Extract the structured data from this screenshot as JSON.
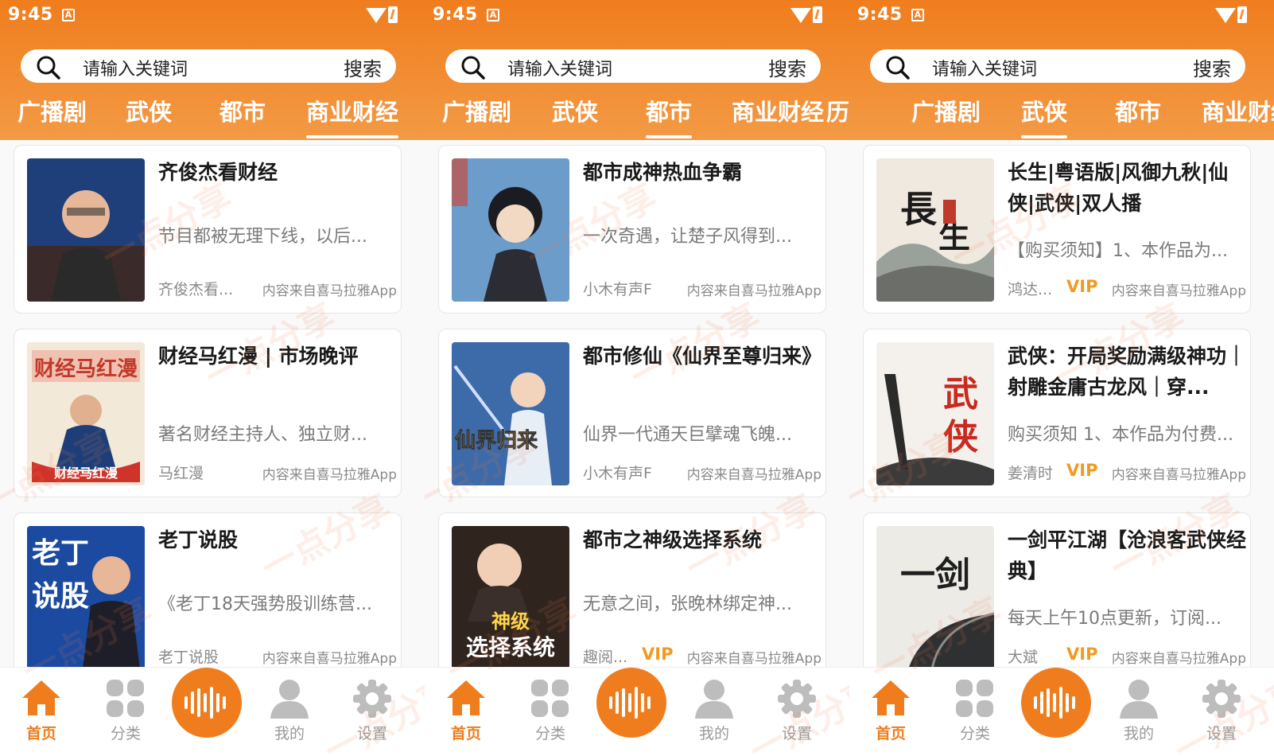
{
  "colors": {
    "accent": "#f07d1d",
    "vip": "#f29a1f"
  },
  "panels": [
    {
      "status": {
        "time": "9:45",
        "badge": "A"
      },
      "search": {
        "placeholder": "请输入关键词",
        "button": "搜索"
      },
      "tabs": [
        {
          "label": "广播剧",
          "active": false
        },
        {
          "label": "武侠",
          "active": false
        },
        {
          "label": "都市",
          "active": false
        },
        {
          "label": "商业财经",
          "active": true
        }
      ],
      "cards": [
        {
          "title": "齐俊杰看财经",
          "desc": "节目都被无理下线，以后...",
          "author": "齐俊杰看...",
          "vip": "",
          "source": "内容来自喜马拉雅App",
          "cover": "portrait-blue"
        },
        {
          "title": "财经马红漫 | 市场晚评",
          "desc": "著名财经主持人、独立财...",
          "author": "马红漫",
          "vip": "",
          "source": "内容来自喜马拉雅App",
          "cover": "mahongman"
        },
        {
          "title": "老丁说股",
          "desc": "《老丁18天强势股训练营...",
          "author": "老丁说股",
          "vip": "",
          "source": "内容来自喜马拉雅App",
          "cover": "laoding"
        }
      ]
    },
    {
      "status": {
        "time": "9:45",
        "badge": "A"
      },
      "search": {
        "placeholder": "请输入关键词",
        "button": "搜索"
      },
      "tabs": [
        {
          "label": "广播剧",
          "active": false
        },
        {
          "label": "武侠",
          "active": false
        },
        {
          "label": "都市",
          "active": true
        },
        {
          "label": "商业财经",
          "active": false
        },
        {
          "label": "历史",
          "active": false
        }
      ],
      "cards": [
        {
          "title": "都市成神热血争霸",
          "desc": "一次奇遇，让楚子风得到...",
          "author": "小木有声F",
          "vip": "",
          "source": "内容来自喜马拉雅App",
          "cover": "anime-boy"
        },
        {
          "title": "都市修仙《仙界至尊归来》",
          "desc": "仙界一代通天巨擘魂飞魄...",
          "author": "小木有声F",
          "vip": "",
          "source": "内容来自喜马拉雅App",
          "cover": "xianjie"
        },
        {
          "title": "都市之神级选择系统",
          "desc": "无意之间，张晚林绑定神...",
          "author": "趣阅...",
          "vip": "VIP",
          "source": "内容来自喜马拉雅App",
          "cover": "shenji"
        }
      ]
    },
    {
      "status": {
        "time": "9:45",
        "badge": "A"
      },
      "search": {
        "placeholder": "请输入关键词",
        "button": "搜索"
      },
      "tabs": [
        {
          "label": "广播剧",
          "active": false
        },
        {
          "label": "武侠",
          "active": true
        },
        {
          "label": "都市",
          "active": false
        },
        {
          "label": "商业财经",
          "active": false
        }
      ],
      "cards": [
        {
          "title": "长生|粤语版|风御九秋|仙侠|武侠|双人播",
          "desc": "【购买须知】1、本作品为...",
          "author": "鸿达...",
          "vip": "VIP",
          "source": "内容来自喜马拉雅App",
          "cover": "changsheng"
        },
        {
          "title": "武侠：开局奖励满级神功｜射雕金庸古龙风｜穿...",
          "desc": "购买须知 1、本作品为付费...",
          "author": "姜清时",
          "vip": "VIP",
          "source": "内容来自喜马拉雅App",
          "cover": "wuxia"
        },
        {
          "title": "一剑平江湖【沧浪客武侠经典】",
          "desc": "每天上午10点更新，订阅...",
          "author": "大斌",
          "vip": "VIP",
          "source": "内容来自喜马拉雅App",
          "cover": "yijian"
        }
      ]
    }
  ],
  "nav": [
    {
      "label": "首页",
      "icon": "home-icon",
      "active": true
    },
    {
      "label": "分类",
      "icon": "category-icon",
      "active": false
    },
    {
      "label": "",
      "icon": "audio-wave-icon",
      "active": false
    },
    {
      "label": "我的",
      "icon": "person-icon",
      "active": false
    },
    {
      "label": "设置",
      "icon": "gear-icon",
      "active": false
    }
  ],
  "watermark": "一点分享",
  "cover_text": {
    "mahongman_top": "财经马红漫",
    "mahongman_bottom": "财经马红漫",
    "laoding": "老丁说股",
    "xianjie": "仙界归来",
    "shenji": "神级选择系统",
    "changsheng": "長生",
    "wuxia": "武侠",
    "yijian": "一剑"
  }
}
